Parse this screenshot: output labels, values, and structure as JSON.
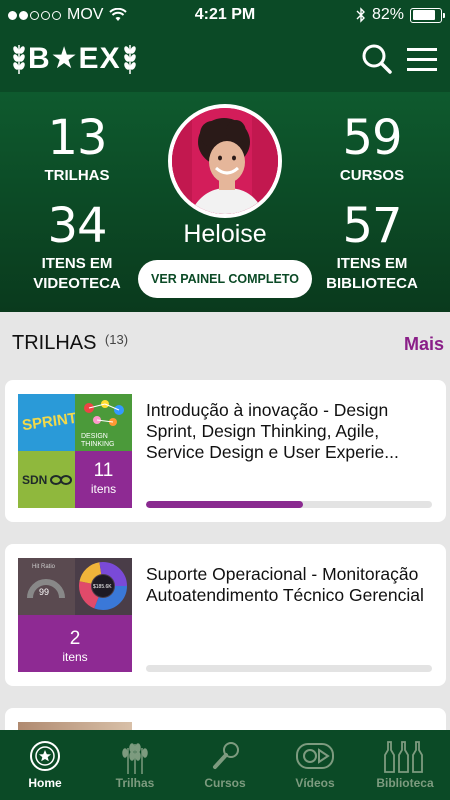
{
  "status_bar": {
    "carrier": "MOV",
    "signal_bars": 2,
    "time": "4:21 PM",
    "battery": "82%",
    "battery_level": 0.82
  },
  "header": {
    "logo_text": "B★EX",
    "icons": [
      "search-icon",
      "menu-icon"
    ]
  },
  "profile": {
    "name": "Heloise",
    "stats": [
      {
        "value": "13",
        "label": "TRILHAS"
      },
      {
        "value": "59",
        "label": "CURSOS"
      },
      {
        "value": "34",
        "label_lines": [
          "ITENS EM",
          "VIDEOTECA"
        ]
      },
      {
        "value": "57",
        "label_lines": [
          "ITENS EM",
          "BIBLIOTECA"
        ]
      }
    ],
    "panel_button": "VER PAINEL COMPLETO"
  },
  "trails_section": {
    "title": "TRILHAS",
    "count": "(13)",
    "more_link": "Mais",
    "cards": [
      {
        "title": "Introdução à inovação - Design Sprint, Design Thinking, Agile, Service Design e User Experie...",
        "item_count": "11",
        "item_label": "itens",
        "thumb_texts": [
          "SPRINT",
          "DESIGN THINKING",
          "SDN"
        ],
        "progress": 0.55
      },
      {
        "title": "Suporte Operacional - Monitoração Autoatendimento Técnico Gerencial",
        "item_count": "2",
        "item_label": "itens",
        "thumb_texts": [
          "Hit Ratio",
          "99",
          "$185.6K"
        ],
        "progress": 0
      }
    ]
  },
  "bottom_nav": {
    "items": [
      {
        "label": "Home",
        "icon": "home-badge-icon",
        "active": true
      },
      {
        "label": "Trilhas",
        "icon": "wheat-icon",
        "active": false
      },
      {
        "label": "Cursos",
        "icon": "microphone-icon",
        "active": false
      },
      {
        "label": "Vídeos",
        "icon": "video-icon",
        "active": false
      },
      {
        "label": "Biblioteca",
        "icon": "bottles-icon",
        "active": false
      }
    ]
  },
  "colors": {
    "brand_green": "#0b4a26",
    "accent_purple": "#8a1f88",
    "avatar_bg": "#d31d5a"
  }
}
